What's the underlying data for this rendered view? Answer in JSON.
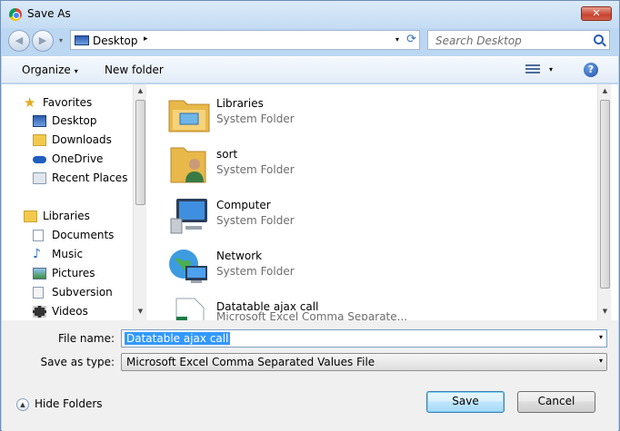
{
  "window": {
    "title": "Save As",
    "close_label": "✕"
  },
  "nav": {
    "back_label": "◀",
    "forward_label": "▶",
    "recent_label": "▾",
    "address": {
      "location": "Desktop",
      "arrow": "▸",
      "dropdown": "▾",
      "refresh": "⟳"
    },
    "search_placeholder": "Search Desktop"
  },
  "toolbar": {
    "organize": "Organize",
    "organize_arrow": "▾",
    "new_folder": "New folder",
    "view_arrow": "▾",
    "help": "?"
  },
  "sidebar": {
    "favorites_header": "Favorites",
    "favorites": [
      {
        "label": "Desktop",
        "icon": "desktop-icon"
      },
      {
        "label": "Downloads",
        "icon": "downloads-icon"
      },
      {
        "label": "OneDrive",
        "icon": "onedrive-icon"
      },
      {
        "label": "Recent Places",
        "icon": "recent-places-icon"
      }
    ],
    "libraries_header": "Libraries",
    "libraries": [
      {
        "label": "Documents",
        "icon": "documents-icon"
      },
      {
        "label": "Music",
        "icon": "music-icon"
      },
      {
        "label": "Pictures",
        "icon": "pictures-icon"
      },
      {
        "label": "Subversion",
        "icon": "subversion-icon"
      },
      {
        "label": "Videos",
        "icon": "videos-icon"
      }
    ],
    "scroll_up": "▲",
    "scroll_down": "▼"
  },
  "files": [
    {
      "name": "Libraries",
      "type": "System Folder",
      "icon": "libraries-folder-icon"
    },
    {
      "name": "sort",
      "type": "System Folder",
      "icon": "user-folder-icon"
    },
    {
      "name": "Computer",
      "type": "System Folder",
      "icon": "computer-icon"
    },
    {
      "name": "Network",
      "type": "System Folder",
      "icon": "network-icon"
    },
    {
      "name": "Datatable ajax call",
      "type": "Microsoft Excel Comma Separate...",
      "icon": "excel-csv-icon"
    }
  ],
  "file_scroll": {
    "up": "▲",
    "down": "▼"
  },
  "form": {
    "file_name_label": "File name:",
    "file_name_value": "Datatable ajax call",
    "file_name_drop": "▾",
    "save_type_label": "Save as type:",
    "save_type_value": "Microsoft Excel Comma Separated Values File",
    "save_type_drop": "▾"
  },
  "footer": {
    "hide_folders": "Hide Folders",
    "hide_icon": "▲",
    "save": "Save",
    "cancel": "Cancel"
  },
  "colors": {
    "chrome": "#bcd7f2",
    "selection": "#3399ff",
    "accent": "#2a5db0"
  }
}
